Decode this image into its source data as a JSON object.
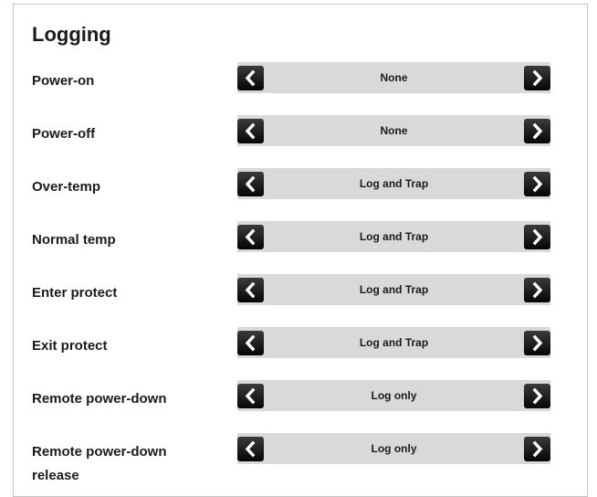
{
  "section": {
    "title": "Logging"
  },
  "rows": [
    {
      "label": "Power-on",
      "value": "None"
    },
    {
      "label": "Power-off",
      "value": "None"
    },
    {
      "label": "Over-temp",
      "value": "Log and Trap"
    },
    {
      "label": "Normal temp",
      "value": "Log and Trap"
    },
    {
      "label": "Enter protect",
      "value": "Log and Trap"
    },
    {
      "label": "Exit protect",
      "value": "Log and Trap"
    },
    {
      "label": "Remote power-down",
      "value": "Log only"
    },
    {
      "label": "Remote power-down release",
      "value": "Log only"
    }
  ],
  "icons": {
    "prev": "chevron-left-icon",
    "next": "chevron-right-icon"
  },
  "colors": {
    "track": "#d9d9d9",
    "arrow_button": "#1a1a1a",
    "text": "#1b1b1b"
  }
}
